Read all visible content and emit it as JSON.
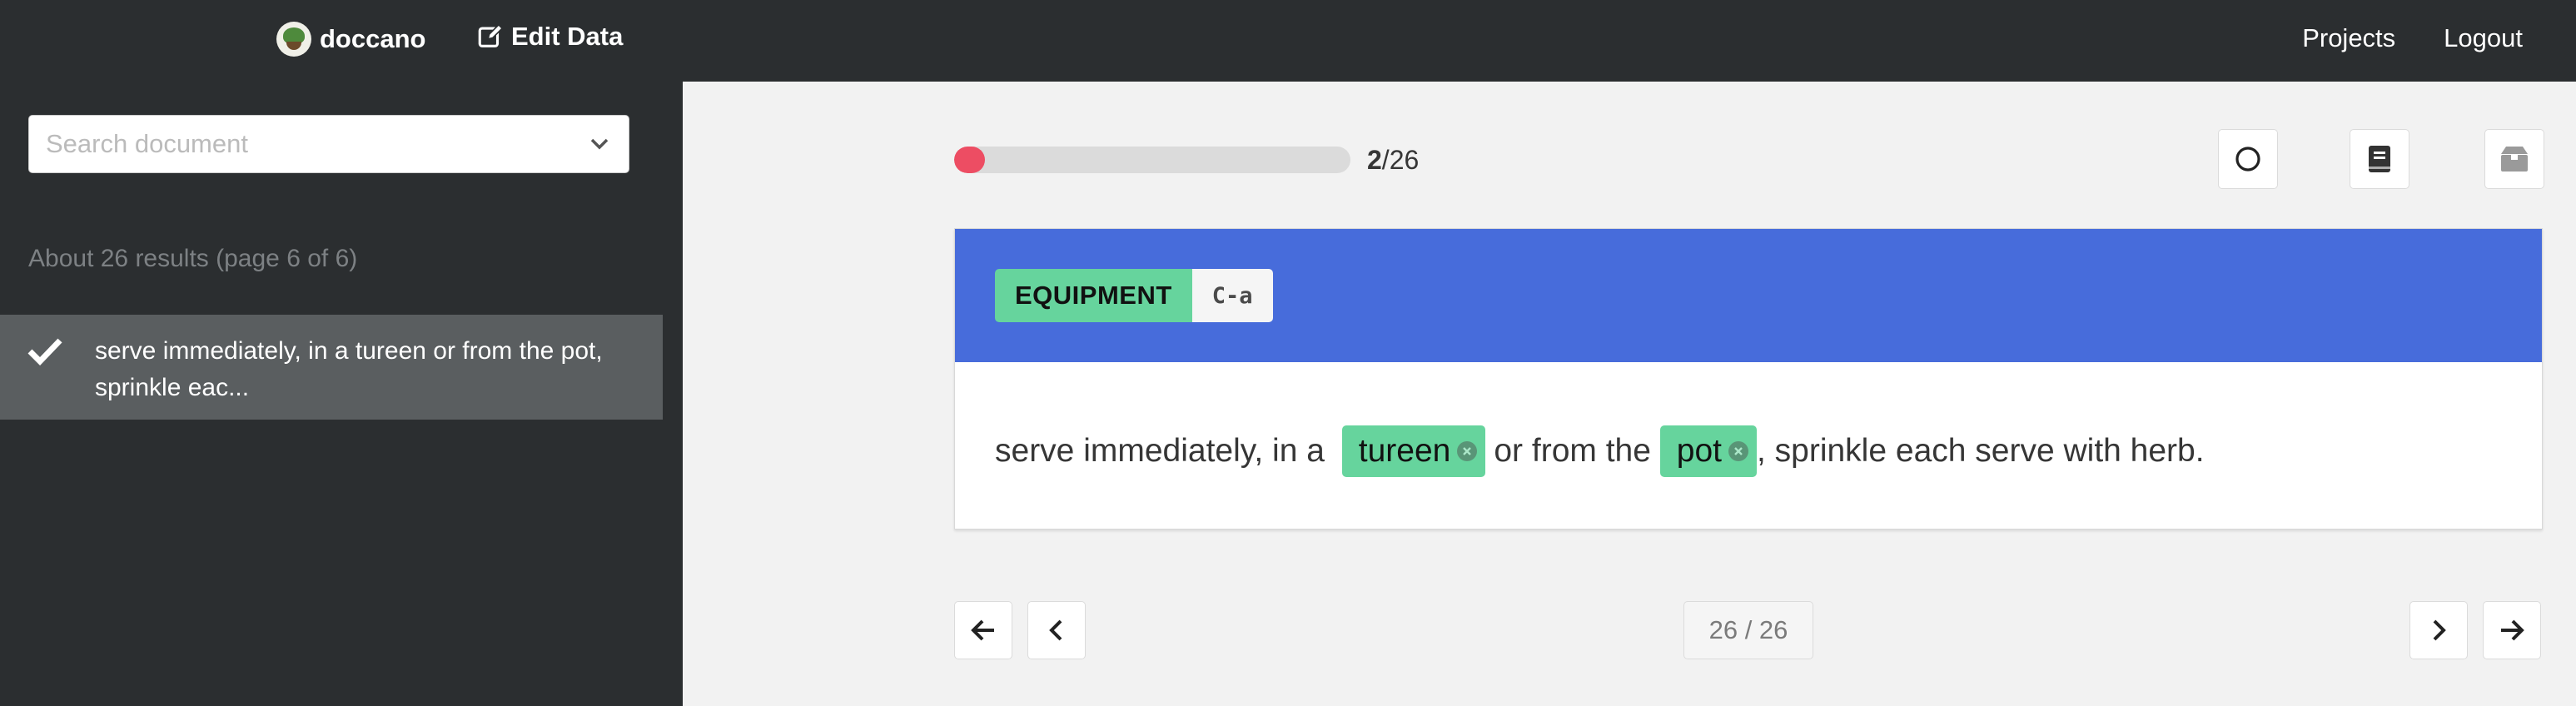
{
  "navbar": {
    "brand": "doccano",
    "edit_label": "Edit Data",
    "links": [
      "Projects",
      "Logout"
    ]
  },
  "sidebar": {
    "search_placeholder": "Search document",
    "results_text": "About 26 results (page 6 of 6)",
    "documents": [
      {
        "text": "serve immediately, in a tureen or from the pot, sprinkle eac...",
        "done": true
      }
    ]
  },
  "progress": {
    "current": "2",
    "total": "/26",
    "fraction": 0.077
  },
  "toolbar": {
    "icons": [
      "circle-icon",
      "book-icon",
      "archive-icon"
    ]
  },
  "labels": [
    {
      "name": "EQUIPMENT",
      "shortcut": "C-a",
      "color": "#66d49d"
    }
  ],
  "document": {
    "segments": [
      {
        "text": "serve immediately, in a ",
        "entity": false
      },
      {
        "text": "tureen",
        "entity": true
      },
      {
        "text": "or from the ",
        "entity": false
      },
      {
        "text": "pot",
        "entity": true
      },
      {
        "text": ", sprinkle each serve with herb.",
        "entity": false
      }
    ]
  },
  "pagination": {
    "indicator": "26 / 26"
  },
  "colors": {
    "navbar": "#2b2e30",
    "header": "#476cdb",
    "entity": "#66d49d",
    "progress": "#ed4d63"
  }
}
